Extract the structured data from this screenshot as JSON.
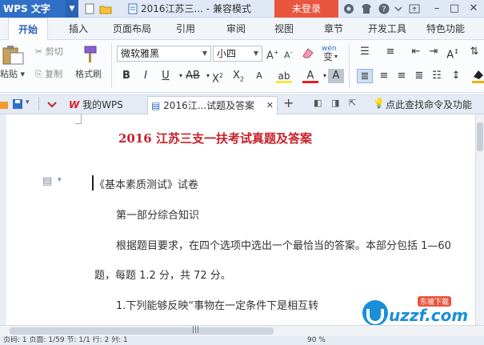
{
  "app": {
    "name": "WPS 文字",
    "document_title": "2016江苏三...",
    "mode": "兼容模式",
    "login_label": "未登录"
  },
  "menu": {
    "items": [
      {
        "label": "开始",
        "active": true
      },
      {
        "label": "插入"
      },
      {
        "label": "页面布局"
      },
      {
        "label": "引用"
      },
      {
        "label": "审阅"
      },
      {
        "label": "视图"
      },
      {
        "label": "章节"
      },
      {
        "label": "开发工具"
      },
      {
        "label": "特色功能"
      }
    ]
  },
  "ribbon": {
    "paste_label": "粘贴",
    "cut_label": "剪切",
    "copy_label": "复制",
    "format_painter_label": "格式刷",
    "font_family": "微软雅黑",
    "font_size": "小四",
    "phonetic_label": "wén"
  },
  "tabs": {
    "home_tab": "我的WPS",
    "doc_tab": "2016江...试题及答案",
    "search_hint": "点此查找命令及功能"
  },
  "document": {
    "title": "2016 江苏三支一扶考试真题及答案",
    "line1": "《基本素质测试》试卷",
    "line2": "第一部分综合知识",
    "line3": "根据题目要求，在四个选项中选出一个最恰当的答案。本部分包括 1—60",
    "line4": "题，每题 1.2 分，共 72 分。",
    "line5": "1.下列能够反映“事物在一定条件下是相互转"
  },
  "status": {
    "text": "页码: 1   页面: 1/59   节: 1/1   行: 2   列: 1",
    "zoom": "90 %"
  },
  "watermark": {
    "text": "uzzf.com",
    "badge": "东坡下载"
  },
  "colors": {
    "accent": "#2f6fc6",
    "login": "#e9553f",
    "doc_title": "#c8202a",
    "wps_red": "#d9202a"
  }
}
